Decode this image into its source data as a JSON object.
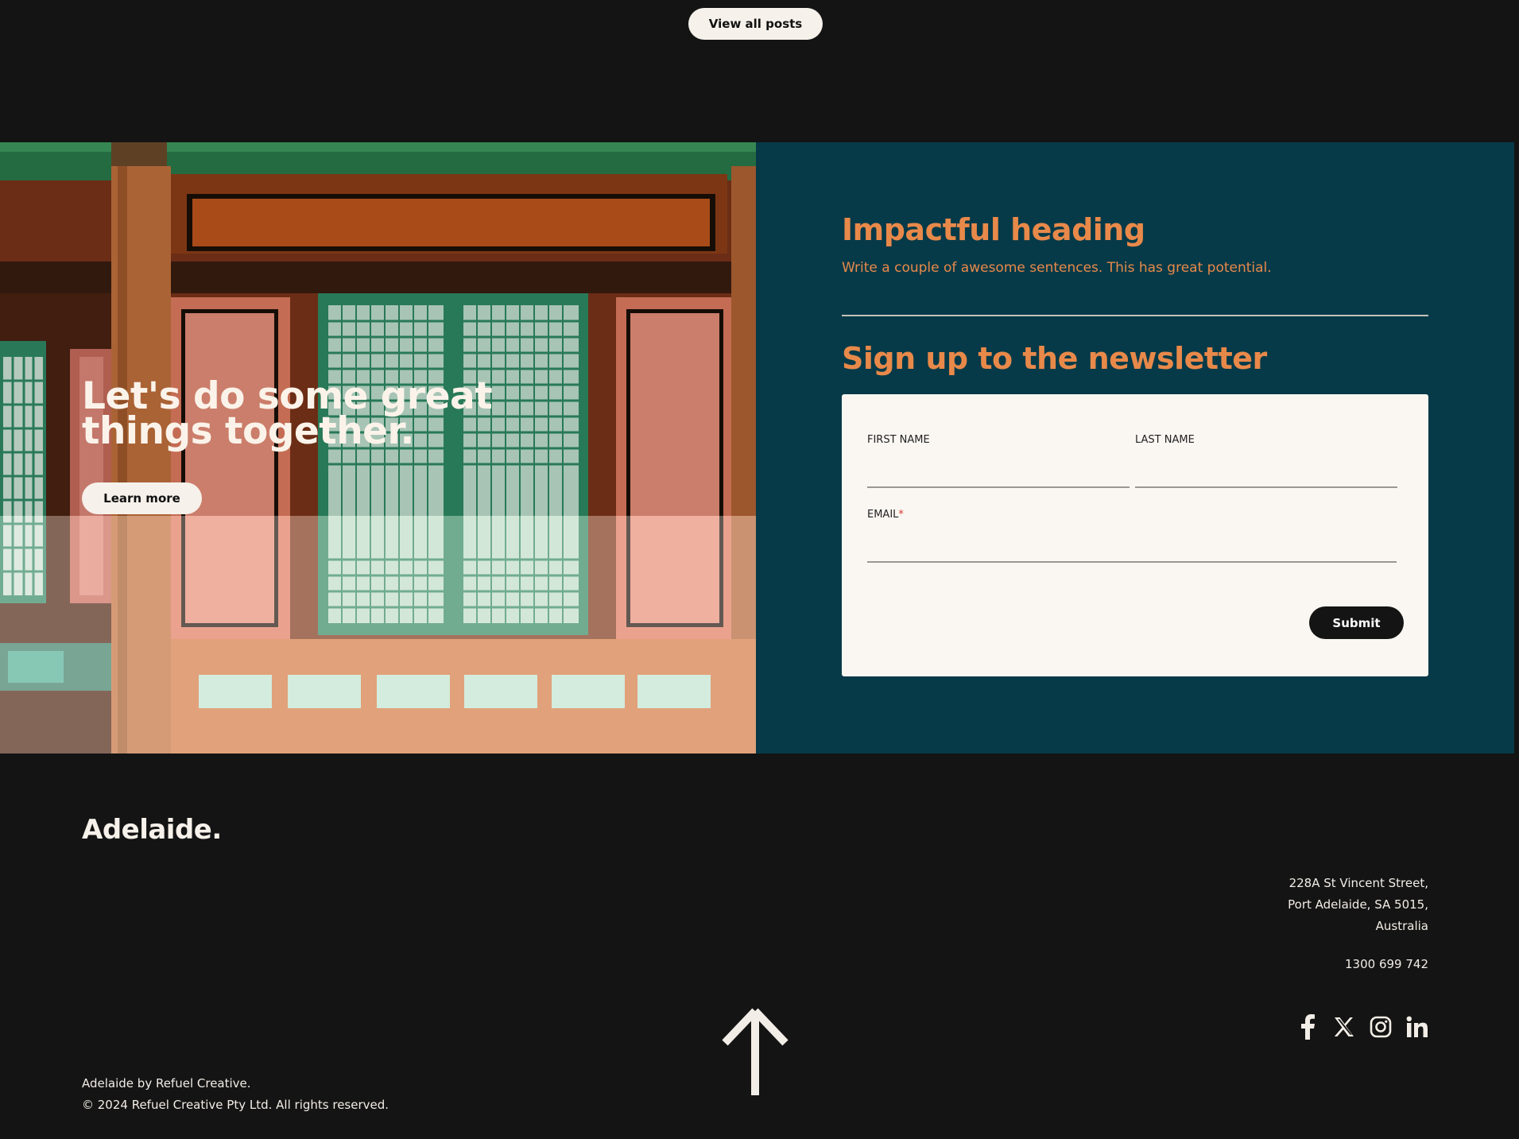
{
  "top": {
    "view_all_label": "View all posts"
  },
  "hero": {
    "title": "Let's do some great things together.",
    "learn_more_label": "Learn more"
  },
  "panel": {
    "heading": "Impactful heading",
    "subtext": "Write a couple of awesome sentences. This has great potential.",
    "newsletter_heading": "Sign up to the newsletter",
    "form": {
      "first_name_label": "FIRST NAME",
      "first_name_value": "",
      "last_name_label": "LAST NAME",
      "last_name_value": "",
      "email_label": "EMAIL",
      "email_required_mark": "*",
      "email_value": "",
      "submit_label": "Submit"
    }
  },
  "footer": {
    "logo": "Adelaide.",
    "address_line1": "228A St Vincent Street,",
    "address_line2": "Port Adelaide, SA 5015,",
    "address_line3": "Australia",
    "phone": "1300 699 742",
    "credit_line1": "Adelaide by Refuel Creative.",
    "credit_line2": "© 2024 Refuel Creative Pty Ltd. All rights reserved.",
    "socials": [
      "facebook-icon",
      "x-icon",
      "instagram-icon",
      "linkedin-icon"
    ],
    "back_to_top_icon": "arrow-up-icon"
  },
  "colors": {
    "background": "#141414",
    "teal": "#073a48",
    "accent_orange": "#e8894a",
    "cream": "#faf7f2"
  }
}
